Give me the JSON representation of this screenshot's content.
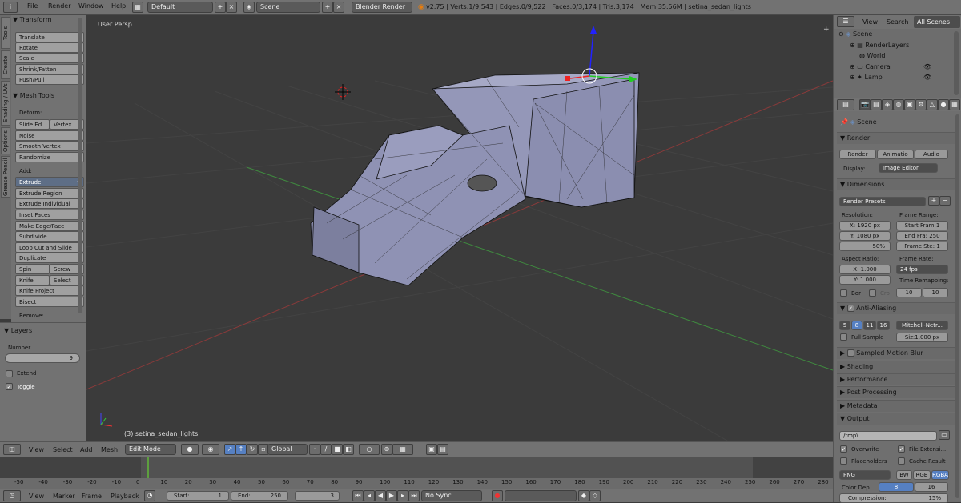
{
  "topbar": {
    "menus": [
      "File",
      "Render",
      "Window",
      "Help"
    ],
    "layout": "Default",
    "scene": "Scene",
    "engine": "Blender Render",
    "stats": "v2.75 | Verts:1/9,543 | Edges:0/9,522 | Faces:0/3,174 | Tris:3,174 | Mem:35.56M | setina_sedan_lights"
  },
  "tabs": [
    "Tools",
    "Create",
    "Shading / UVs",
    "Options",
    "Grease Pencil"
  ],
  "toolshelf": {
    "transform": {
      "title": "Transform",
      "items": [
        "Translate",
        "Rotate",
        "Scale",
        "Shrink/Fatten",
        "Push/Pull"
      ]
    },
    "mesh_tools": {
      "title": "Mesh Tools",
      "deform_label": "Deform:",
      "deform": [
        "Slide Ed",
        "Vertex",
        "Noise",
        "Smooth Vertex",
        "Randomize"
      ],
      "add_label": "Add:",
      "add": [
        "Extrude",
        "Extrude Region",
        "Extrude Individual",
        "Inset Faces",
        "Make Edge/Face",
        "Subdivide",
        "Loop Cut and Slide",
        "Duplicate",
        "Spin",
        "Screw",
        "Knife",
        "Select",
        "Knife Project",
        "Bisect"
      ],
      "remove_label": "Remove:"
    }
  },
  "layers": {
    "title": "Layers",
    "number_label": "Number",
    "number": "9",
    "extend": "Extend",
    "toggle": "Toggle"
  },
  "viewport": {
    "label": "User Persp",
    "object": "(3) setina_sedan_lights"
  },
  "vphead": {
    "menus": [
      "View",
      "Select",
      "Add",
      "Mesh"
    ],
    "mode": "Edit Mode",
    "orientation": "Global"
  },
  "timeline": {
    "ticks": [
      "-50",
      "-40",
      "-30",
      "-20",
      "-10",
      "0",
      "10",
      "20",
      "30",
      "40",
      "50",
      "60",
      "70",
      "80",
      "90",
      "100",
      "110",
      "120",
      "130",
      "140",
      "150",
      "160",
      "170",
      "180",
      "190",
      "200",
      "210",
      "220",
      "230",
      "240",
      "250",
      "260",
      "270",
      "280"
    ],
    "menus": [
      "View",
      "Marker",
      "Frame",
      "Playback"
    ],
    "start_label": "Start:",
    "start": "1",
    "end_label": "End:",
    "end": "250",
    "current": "3",
    "sync": "No Sync"
  },
  "outliner": {
    "menus": [
      "View",
      "Search"
    ],
    "filter": "All Scenes",
    "rows": [
      "Scene",
      "RenderLayers",
      "World",
      "Camera",
      "Lamp"
    ]
  },
  "properties": {
    "context": "Scene",
    "render": {
      "title": "Render",
      "buttons": [
        "Render",
        "Animatio",
        "Audio"
      ],
      "display_label": "Display:",
      "display": "Image Editor"
    },
    "dimensions": {
      "title": "Dimensions",
      "presets": "Render Presets",
      "resolution_label": "Resolution:",
      "res_x": "X:",
      "res_x_val": "1920 px",
      "res_y": "Y:",
      "res_y_val": "1080 px",
      "res_pct": "50%",
      "frame_range_label": "Frame Range:",
      "start": "Start Fram:1",
      "end": "End Fra: 250",
      "step": "Frame Ste: 1",
      "aspect_label": "Aspect Ratio:",
      "aspect_x": "X:",
      "aspect_x_val": "1.000",
      "aspect_y": "Y:",
      "aspect_y_val": "1.000",
      "frame_rate_label": "Frame Rate:",
      "fps": "24 fps",
      "time_remap_label": "Time Remapping:",
      "remap_old": "10",
      "remap_new": "10",
      "border": "Bor",
      "crop": "Cro"
    },
    "antialiasing": {
      "title": "Anti-Aliasing",
      "samples": [
        "5",
        "8",
        "11",
        "16"
      ],
      "filter": "Mitchell-Netr...",
      "full_sample": "Full Sample",
      "size": "Siz:1.000 px"
    },
    "collapsed": [
      "Sampled Motion Blur",
      "Shading",
      "Performance",
      "Post Processing",
      "Metadata"
    ],
    "output": {
      "title": "Output",
      "path": "/tmp\\",
      "overwrite": "Overwrite",
      "file_ext": "File Extensi...",
      "placeholders": "Placeholders",
      "cache": "Cache Result",
      "format": "PNG",
      "bw": "BW",
      "rgb": "RGB",
      "rgba": "RGBA",
      "color_depth_label": "Color Dep",
      "depth_8": "8",
      "depth_16": "16",
      "compression": "Compression:",
      "compression_val": "15%"
    }
  }
}
